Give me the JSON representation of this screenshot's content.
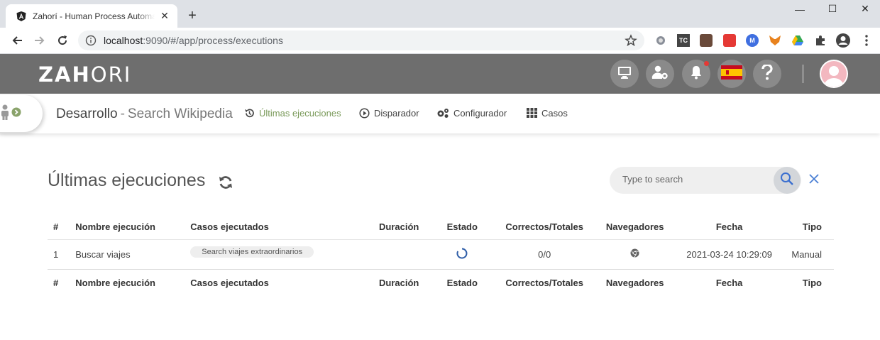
{
  "browser": {
    "tab_title": "Zahorí - Human Process Automation",
    "url_host": "localhost",
    "url_path": ":9090/#/app/process/executions",
    "minimize": "—",
    "maximize": "☐",
    "close": "✕",
    "new_tab": "+",
    "extensions": [
      {
        "name": "ext-circle-icon",
        "label": ""
      },
      {
        "name": "ext-tc-icon",
        "label": "TC"
      },
      {
        "name": "ext-screen-icon",
        "label": ""
      },
      {
        "name": "ext-red-icon",
        "label": ""
      },
      {
        "name": "ext-m-icon",
        "label": "M"
      },
      {
        "name": "ext-fox-icon",
        "label": ""
      },
      {
        "name": "ext-drive-icon",
        "label": ""
      },
      {
        "name": "extensions-puzzle-icon",
        "label": ""
      }
    ]
  },
  "header": {
    "logo_bold": "ZAH",
    "logo_thin": "ORI",
    "colors": {
      "header_bg": "#6e6e6e",
      "button_bg": "#8a8a8a",
      "accent": "#7a9a5a",
      "notification": "#e53935"
    }
  },
  "subnav": {
    "environment": "Desarrollo",
    "separator": "-",
    "process": "Search Wikipedia",
    "menu": [
      {
        "label": "Últimas ejecuciones",
        "icon": "history-icon",
        "active": true
      },
      {
        "label": "Disparador",
        "icon": "play-circle-icon",
        "active": false
      },
      {
        "label": "Configurador",
        "icon": "gears-icon",
        "active": false
      },
      {
        "label": "Casos",
        "icon": "grid-icon",
        "active": false
      }
    ]
  },
  "main": {
    "title": "Últimas ejecuciones",
    "search_placeholder": "Type to search",
    "table": {
      "headers": [
        "#",
        "Nombre ejecución",
        "Casos ejecutados",
        "Duración",
        "Estado",
        "Correctos/Totales",
        "Navegadores",
        "Fecha",
        "Tipo"
      ],
      "rows": [
        {
          "num": "1",
          "name": "Buscar viajes",
          "cases": "Search viajes extraordinarios",
          "duration": "",
          "status": "running",
          "correct_total": "0/0",
          "browser": "chrome-icon",
          "date": "2021-03-24 10:29:09",
          "type": "Manual"
        }
      ]
    }
  }
}
